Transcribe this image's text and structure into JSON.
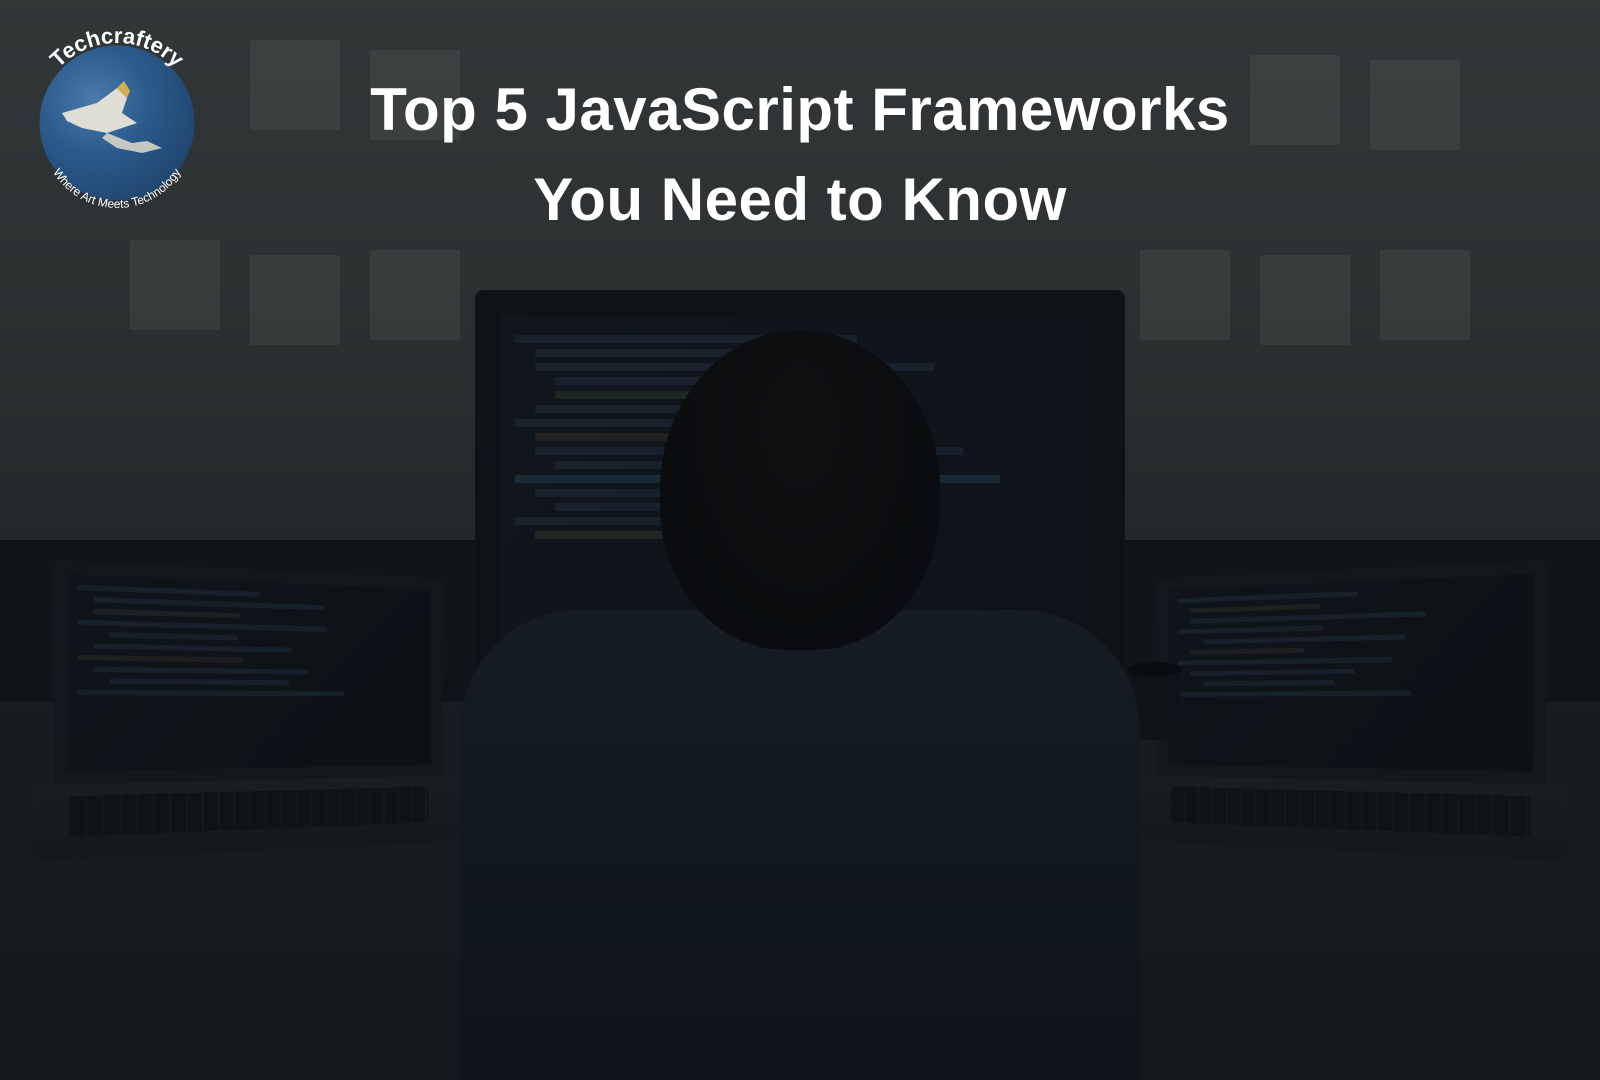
{
  "logo": {
    "brand_name": "Techcraftery",
    "tagline": "Where Art Meets Technology"
  },
  "headline": {
    "line1": "Top 5 JavaScript Frameworks",
    "line2": "You Need to Know"
  }
}
